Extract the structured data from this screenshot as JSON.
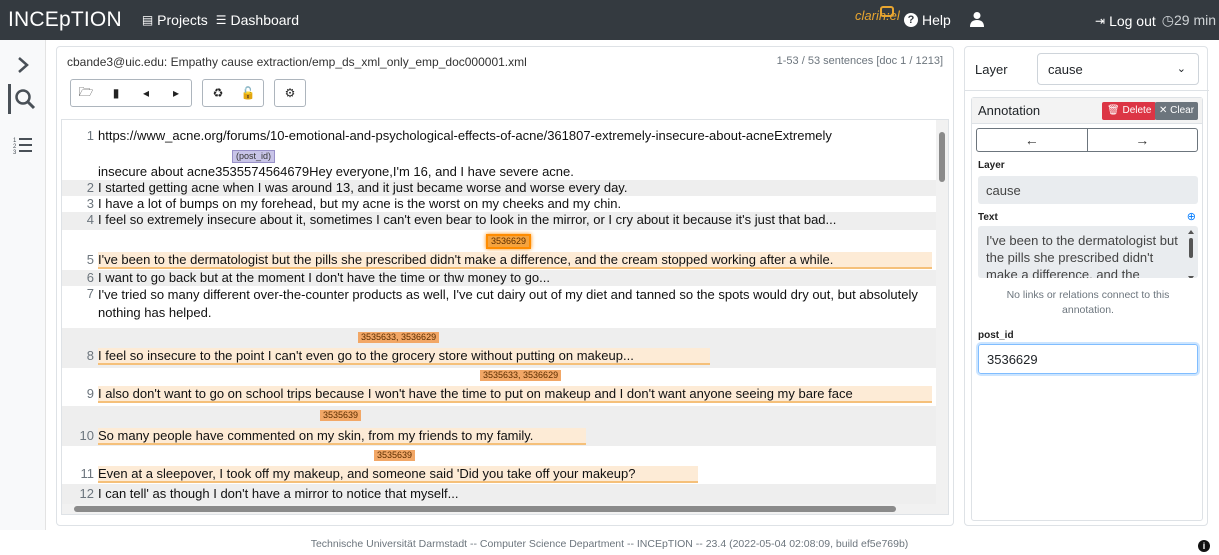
{
  "navbar": {
    "brand": "INCEpTION",
    "projects": "Projects",
    "dashboard": "Dashboard",
    "clarin": "clarin:el",
    "help": "Help",
    "logout": "Log out",
    "timer": "29 min"
  },
  "main": {
    "title": "cbande3@uic.edu: Empathy cause extraction/emp_ds_xml_only_emp_doc000001.xml",
    "sentence_info": "1-53 / 53 sentences [doc 1 / 1213]"
  },
  "doc": {
    "line1": "https://www_acne.org/forums/10-emotional-and-psychological-effects-of-acne/361807-extremely-insecure-about-acneExtremely",
    "line1b": "insecure about acne3535574564679Hey everyone,I'm 16, and I have severe acne.",
    "postid_tag": "(post_id)",
    "lines": [
      {
        "n": "2",
        "t": "I started getting acne when I was around 13, and it just became worse and worse every day."
      },
      {
        "n": "3",
        "t": "I have a lot of bumps on my forehead, but my acne is the worst on my cheeks and my chin."
      },
      {
        "n": "4",
        "t": "I feel so extremely insecure about it, sometimes I can't even bear to look in the mirror, or I cry about it because it's just that bad..."
      },
      {
        "n": "5",
        "t": "I've been to the dermatologist but the pills she prescribed didn't make a difference, and the cream stopped working after a while.",
        "tag": "3536629"
      },
      {
        "n": "6",
        "t": "I want to go back but at the moment I don't have the time or thw money to go..."
      },
      {
        "n": "7",
        "t": "I've tried so many different over-the-counter products as well, I've cut dairy out of my diet and tanned so the spots would dry out, but absolutely nothing has helped."
      },
      {
        "n": "8",
        "t": "I feel so insecure to the point I can't even go to the grocery store without putting on makeup...",
        "tag": "3535633, 3536629"
      },
      {
        "n": "9",
        "t": "I also don't want to go on school trips because I won't have the time to put on makeup and I don't want anyone seeing my bare face",
        "tag": "3535633, 3536629"
      },
      {
        "n": "10",
        "t": "So many people have commented on my skin, from my friends to my family.",
        "tag": "3535639"
      },
      {
        "n": "11",
        "t": "Even at a sleepover, I took off my makeup, and someone said 'Did you take off your makeup?",
        "tag": "3535639"
      },
      {
        "n": "12",
        "t": "I can tell' as though I don't have a mirror to notice that myself..."
      }
    ]
  },
  "right": {
    "layer_label": "Layer",
    "layer_value": "cause",
    "annotation_title": "Annotation",
    "delete": "Delete",
    "clear": "Clear",
    "prev": "←",
    "next": "→",
    "field_layer_label": "Layer",
    "field_layer_value": "cause",
    "field_text_label": "Text",
    "field_text_value": "I've been to the dermatologist but the pills she prescribed didn't make a difference, and the cream",
    "no_links": "No links or relations connect to this annotation.",
    "post_id_label": "post_id",
    "post_id_value": "3536629"
  },
  "footer": "Technische Universität Darmstadt -- Computer Science Department -- INCEpTION -- 23.4 (2022-05-04 02:08:09, build ef5e769b)"
}
